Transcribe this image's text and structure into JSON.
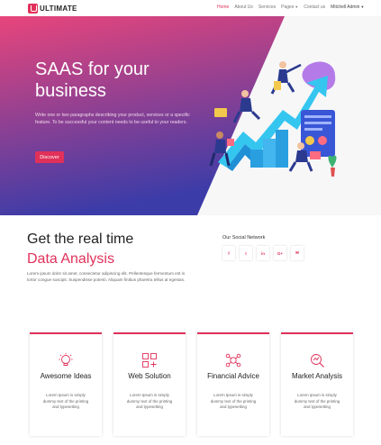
{
  "nav": {
    "logo_letter": "U",
    "logo_text": "ULTIMATE",
    "items": [
      {
        "label": "Home",
        "active": true
      },
      {
        "label": "About Us",
        "active": false
      },
      {
        "label": "Services",
        "active": false
      },
      {
        "label": "Pages",
        "active": false,
        "dropdown": true
      },
      {
        "label": "Contact us",
        "active": false
      }
    ],
    "user": "Mitchell Admin"
  },
  "hero": {
    "title": "SAAS for your business",
    "description": "Write one or two paragraphs describing your product, services or a specific feature. To be successful your content needs to be useful to your readers.",
    "button": "Discover",
    "gradient_top": "#e8457b",
    "gradient_bottom": "#3b3ca8"
  },
  "section": {
    "headline_line1": "Get the real time",
    "headline_line2": "Data Analysis",
    "body": "Lorem ipsum dolor sit amet, consectetur adipiscing elit. Pellentesque fermentum est in tortor congue suscipit. Suspendisse potenti. Aliquam finibus pharetra tellus at egestas.",
    "social_title": "Our Social Network",
    "social": [
      {
        "icon": "facebook-icon",
        "glyph": "f"
      },
      {
        "icon": "twitter-icon",
        "glyph": "t"
      },
      {
        "icon": "linkedin-icon",
        "glyph": "in"
      },
      {
        "icon": "google-plus-icon",
        "glyph": "G+"
      },
      {
        "icon": "email-icon",
        "glyph": "✉"
      }
    ]
  },
  "cards": [
    {
      "icon": "lightbulb-icon",
      "title": "Awesome Ideas",
      "text": "Lorem Ipsum is simply dummy text of the printing and typesetting"
    },
    {
      "icon": "web-grid-icon",
      "title": "Web Solution",
      "text": "Lorem Ipsum is simply dummy text of the printing and typesetting"
    },
    {
      "icon": "financial-icon",
      "title": "Financial Advice",
      "text": "Lorem Ipsum is simply dummy text of the printing and typesetting"
    },
    {
      "icon": "market-analysis-icon",
      "title": "Market Analysis",
      "text": "Lorem Ipsum is simply dummy text of the printing and typesetting"
    }
  ],
  "accent": "#e0315a"
}
